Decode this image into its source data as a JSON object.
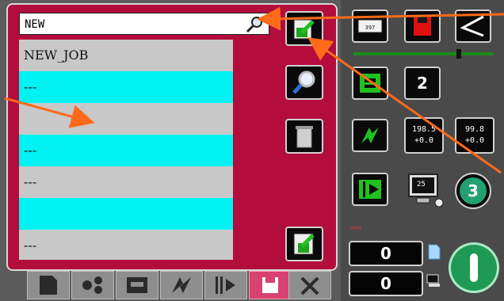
{
  "search": {
    "value": "NEW"
  },
  "job_list": {
    "rows": [
      {
        "label": "NEW_JOB"
      },
      {
        "label": "---"
      },
      {
        "label": ""
      },
      {
        "label": "---"
      },
      {
        "label": "---"
      },
      {
        "label": ""
      },
      {
        "label": "---"
      }
    ]
  },
  "right_panel": {
    "speed_button_value": "2",
    "tool_button_value": "3",
    "readout_1": {
      "top": "198.5",
      "bottom": "+0.0"
    },
    "readout_2": {
      "top": "99.8",
      "bottom": "+0.0"
    },
    "screen_value": "25",
    "small_label": "mm",
    "counter_1": "0",
    "counter_2": "0"
  },
  "colors": {
    "panel_red": "#b20d3d",
    "row_cyan": "#00f2f2",
    "row_gray": "#c8c8c8",
    "button_green": "#1fc21f",
    "annotation_arrow": "#ff6a1a"
  }
}
